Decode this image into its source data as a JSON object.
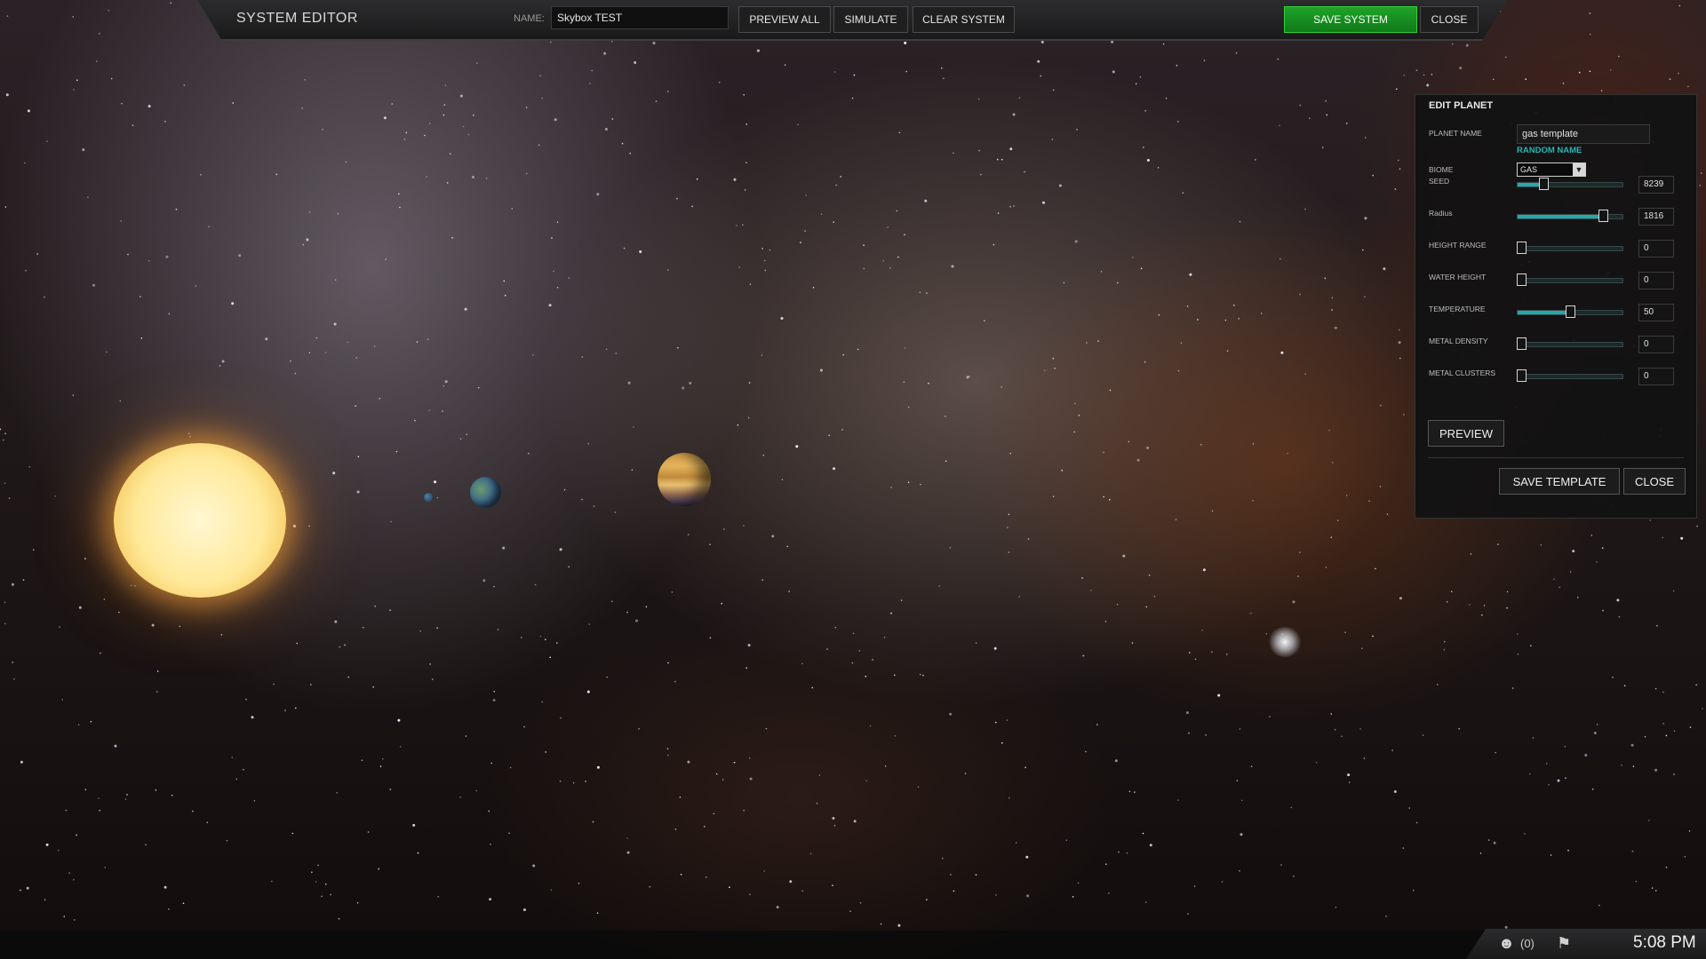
{
  "topbar": {
    "title": "SYSTEM EDITOR",
    "name_label": "NAME:",
    "name_value": "Skybox TEST",
    "buttons": {
      "preview_all": "PREVIEW ALL",
      "simulate": "SIMULATE",
      "clear_system": "CLEAR SYSTEM",
      "save_system": "SAVE SYSTEM",
      "close": "CLOSE"
    }
  },
  "edit_panel": {
    "title": "EDIT PLANET",
    "planet_name_label": "PLANET NAME",
    "planet_name_value": "gas template",
    "random_name": "RANDOM NAME",
    "biome_label": "BIOME",
    "biome_value": "GAS",
    "sliders": [
      {
        "label": "SEED",
        "value": "8239",
        "level": 0.25
      },
      {
        "label": "Radius",
        "value": "1816",
        "level": 0.81
      },
      {
        "label": "HEIGHT RANGE",
        "value": "0",
        "level": 0.0
      },
      {
        "label": "WATER HEIGHT",
        "value": "0",
        "level": 0.0
      },
      {
        "label": "TEMPERATURE",
        "value": "50",
        "level": 0.5
      },
      {
        "label": "METAL DENSITY",
        "value": "0",
        "level": 0.0
      },
      {
        "label": "METAL CLUSTERS",
        "value": "0",
        "level": 0.0
      }
    ],
    "buttons": {
      "preview": "PREVIEW",
      "save_template": "SAVE TEMPLATE",
      "close": "CLOSE"
    }
  },
  "taskbar": {
    "notifications": "(0)",
    "time": "5:08 PM"
  },
  "colors": {
    "accent_teal": "#23a9ab",
    "save_green": "#1fa32a"
  }
}
